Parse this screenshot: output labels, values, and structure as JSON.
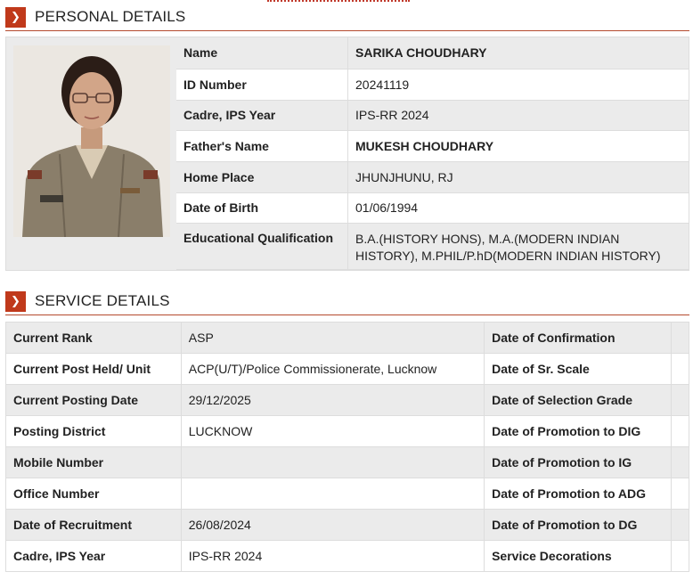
{
  "personal": {
    "title": "PERSONAL DETAILS",
    "icon": "chevron-right-icon",
    "rows": [
      {
        "label": "Name",
        "value": "SARIKA CHOUDHARY",
        "bold": true
      },
      {
        "label": "ID Number",
        "value": "20241119",
        "bold": false
      },
      {
        "label": "Cadre, IPS Year",
        "value": "IPS-RR 2024",
        "bold": false
      },
      {
        "label": "Father's Name",
        "value": "MUKESH CHOUDHARY",
        "bold": true
      },
      {
        "label": "Home Place",
        "value": "JHUNJHUNU, RJ",
        "bold": false
      },
      {
        "label": "Date of Birth",
        "value": "01/06/1994",
        "bold": false
      },
      {
        "label": "Educational Qualification",
        "value": "B.A.(HISTORY HONS), M.A.(MODERN INDIAN HISTORY), M.PHIL/P.hD(MODERN INDIAN HISTORY)",
        "bold": false
      }
    ]
  },
  "service": {
    "title": "SERVICE DETAILS",
    "icon": "chevron-right-icon",
    "rows": [
      {
        "label": "Current Rank",
        "value": "ASP",
        "label2": "Date of Confirmation",
        "value2": ""
      },
      {
        "label": "Current Post Held/ Unit",
        "value": "ACP(U/T)/Police Commissionerate, Lucknow",
        "label2": "Date of Sr. Scale",
        "value2": ""
      },
      {
        "label": "Current Posting Date",
        "value": "29/12/2025",
        "label2": "Date of Selection Grade",
        "value2": ""
      },
      {
        "label": "Posting District",
        "value": "LUCKNOW",
        "label2": "Date of Promotion to DIG",
        "value2": ""
      },
      {
        "label": "Mobile Number",
        "value": "",
        "label2": "Date of Promotion to IG",
        "value2": ""
      },
      {
        "label": "Office Number",
        "value": "",
        "label2": "Date of Promotion to ADG",
        "value2": ""
      },
      {
        "label": "Date of Recruitment",
        "value": "26/08/2024",
        "label2": "Date of Promotion to DG",
        "value2": ""
      },
      {
        "label": "Cadre, IPS Year",
        "value": "IPS-RR 2024",
        "label2": "Service Decorations",
        "value2": ""
      }
    ]
  },
  "colors": {
    "accent": "#c0391b",
    "row_alt": "#ebebeb",
    "border": "#dddddd"
  }
}
